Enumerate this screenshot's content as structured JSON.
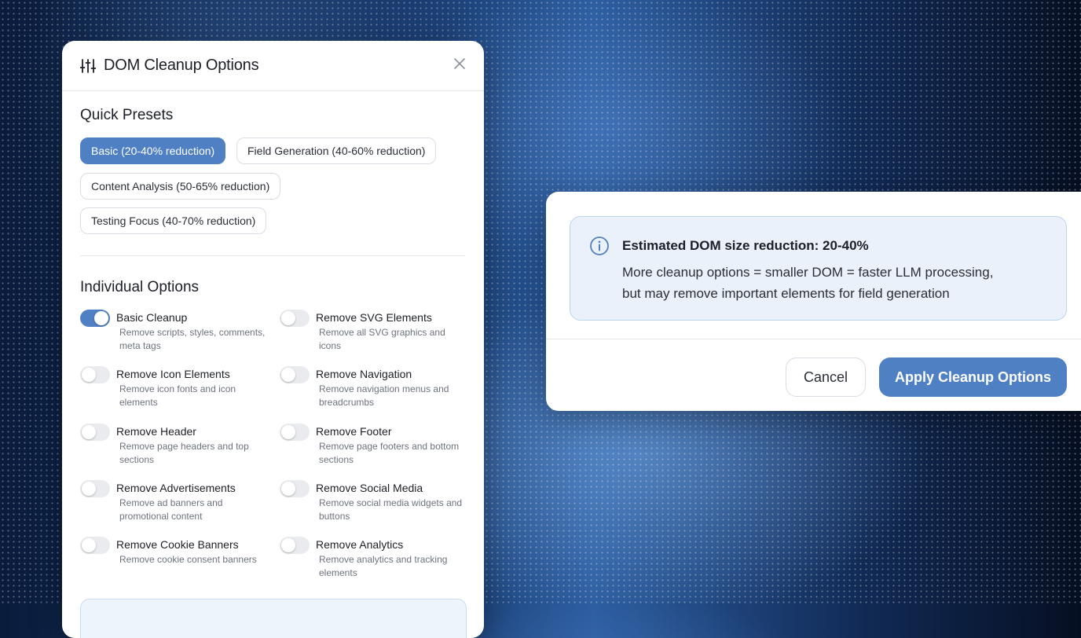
{
  "dialog": {
    "title": "DOM Cleanup Options",
    "title_icon": "sliders-icon",
    "close_icon": "close-icon"
  },
  "presets": {
    "heading": "Quick Presets",
    "items": [
      {
        "label": "Basic (20-40% reduction)",
        "active": true
      },
      {
        "label": "Field Generation (40-60% reduction)",
        "active": false
      },
      {
        "label": "Content Analysis (50-65% reduction)",
        "active": false
      },
      {
        "label": "Testing Focus (40-70% reduction)",
        "active": false
      }
    ]
  },
  "options": {
    "heading": "Individual Options",
    "items": [
      {
        "label": "Basic Cleanup",
        "desc": "Remove scripts, styles, comments, meta tags",
        "on": true
      },
      {
        "label": "Remove SVG Elements",
        "desc": "Remove all SVG graphics and icons",
        "on": false
      },
      {
        "label": "Remove Icon Elements",
        "desc": "Remove icon fonts and icon elements",
        "on": false
      },
      {
        "label": "Remove Navigation",
        "desc": "Remove navigation menus and breadcrumbs",
        "on": false
      },
      {
        "label": "Remove Header",
        "desc": "Remove page headers and top sections",
        "on": false
      },
      {
        "label": "Remove Footer",
        "desc": "Remove page footers and bottom sections",
        "on": false
      },
      {
        "label": "Remove Advertisements",
        "desc": "Remove ad banners and promotional content",
        "on": false
      },
      {
        "label": "Remove Social Media",
        "desc": "Remove social media widgets and buttons",
        "on": false
      },
      {
        "label": "Remove Cookie Banners",
        "desc": "Remove cookie consent banners",
        "on": false
      },
      {
        "label": "Remove Analytics",
        "desc": "Remove analytics and tracking elements",
        "on": false
      }
    ]
  },
  "summary": {
    "info_icon": "info-icon",
    "title": "Estimated DOM size reduction: 20-40%",
    "line1": "More cleanup options = smaller DOM = faster LLM processing,",
    "line2": "but may remove important elements for field generation"
  },
  "actions": {
    "cancel_label": "Cancel",
    "apply_label": "Apply Cleanup Options"
  },
  "colors": {
    "accent": "#4f80c4",
    "info_bg": "#eaf1fa"
  }
}
